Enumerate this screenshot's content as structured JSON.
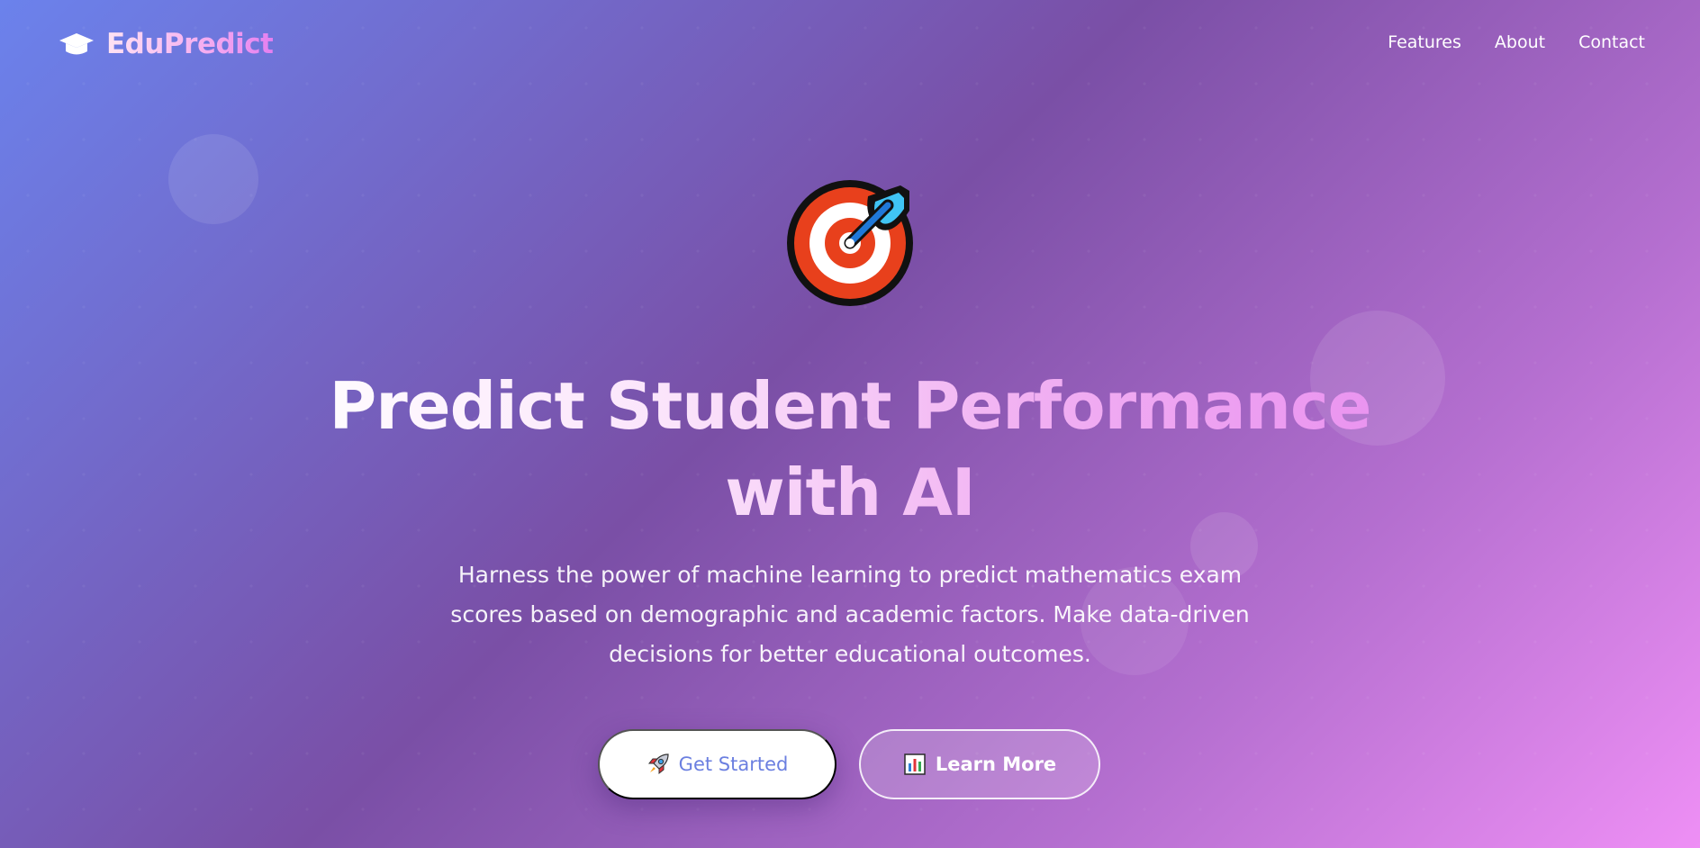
{
  "colors": {
    "gradient_start": "#6b82ec",
    "gradient_mid": "#7a4fa6",
    "gradient_end": "#ee8ff5",
    "primary_button_text": "#6b7fe0",
    "target_red": "#e8401c",
    "dart_blue": "#40c4f4"
  },
  "navbar": {
    "logo_icon": "graduation-cap-icon",
    "logo_text": "EduPredict",
    "links": [
      {
        "label": "Features"
      },
      {
        "label": "About"
      },
      {
        "label": "Contact"
      }
    ]
  },
  "hero": {
    "icon": "direct-hit-target-icon",
    "title": "Predict Student Performance with AI",
    "subtitle": "Harness the power of machine learning to predict mathematics exam scores based on demographic and academic factors. Make data-driven decisions for better educational outcomes.",
    "primary_button": {
      "icon": "rocket-icon",
      "label": "Get Started"
    },
    "secondary_button": {
      "icon": "bar-chart-icon",
      "label": "Learn More"
    }
  }
}
